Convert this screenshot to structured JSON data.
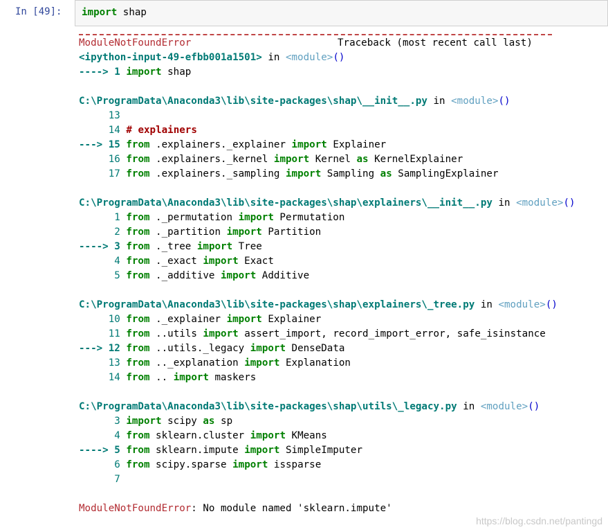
{
  "cell": {
    "prompt": "In  [49]:",
    "code_kw": "import",
    "code_rest": " shap"
  },
  "traceback": {
    "header_error": "ModuleNotFoundError",
    "header_right": "Traceback (most recent call last)",
    "frames": [
      {
        "location": "<ipython-input-49-efbb001a1501>",
        "in_word": " in ",
        "module": "<module>",
        "parens": "()",
        "lines": [
          {
            "marker": "----> ",
            "num": "1",
            "current": true,
            "kw1": "import",
            "rest1": " shap",
            "kw2": "",
            "rest2": "",
            "kw3": "",
            "rest3": ""
          }
        ]
      },
      {
        "location": "C:\\ProgramData\\Anaconda3\\lib\\site-packages\\shap\\__init__.py",
        "in_word": " in ",
        "module": "<module>",
        "parens": "()",
        "lines": [
          {
            "marker": "     ",
            "num": "13",
            "current": false,
            "kw1": "",
            "rest1": "",
            "kw2": "",
            "rest2": "",
            "kw3": "",
            "rest3": ""
          },
          {
            "marker": "     ",
            "num": "14",
            "current": false,
            "comment": "# explainers"
          },
          {
            "marker": "---> ",
            "num": "15",
            "current": true,
            "kw1": "from",
            "rest1": " .explainers._explainer ",
            "kw2": "import",
            "rest2": " Explainer",
            "kw3": "",
            "rest3": ""
          },
          {
            "marker": "     ",
            "num": "16",
            "current": false,
            "kw1": "from",
            "rest1": " .explainers._kernel ",
            "kw2": "import",
            "rest2": " Kernel ",
            "kw3": "as",
            "rest3": " KernelExplainer"
          },
          {
            "marker": "     ",
            "num": "17",
            "current": false,
            "kw1": "from",
            "rest1": " .explainers._sampling ",
            "kw2": "import",
            "rest2": " Sampling ",
            "kw3": "as",
            "rest3": " SamplingExplainer"
          }
        ]
      },
      {
        "location": "C:\\ProgramData\\Anaconda3\\lib\\site-packages\\shap\\explainers\\__init__.py",
        "in_word": " in ",
        "module": "<module>",
        "parens": "()",
        "lines": [
          {
            "marker": "      ",
            "num": "1",
            "current": false,
            "kw1": "from",
            "rest1": " ._permutation ",
            "kw2": "import",
            "rest2": " Permutation",
            "kw3": "",
            "rest3": ""
          },
          {
            "marker": "      ",
            "num": "2",
            "current": false,
            "kw1": "from",
            "rest1": " ._partition ",
            "kw2": "import",
            "rest2": " Partition",
            "kw3": "",
            "rest3": ""
          },
          {
            "marker": "----> ",
            "num": "3",
            "current": true,
            "kw1": "from",
            "rest1": " ._tree ",
            "kw2": "import",
            "rest2": " Tree",
            "kw3": "",
            "rest3": ""
          },
          {
            "marker": "      ",
            "num": "4",
            "current": false,
            "kw1": "from",
            "rest1": " ._exact ",
            "kw2": "import",
            "rest2": " Exact",
            "kw3": "",
            "rest3": ""
          },
          {
            "marker": "      ",
            "num": "5",
            "current": false,
            "kw1": "from",
            "rest1": " ._additive ",
            "kw2": "import",
            "rest2": " Additive",
            "kw3": "",
            "rest3": ""
          }
        ]
      },
      {
        "location": "C:\\ProgramData\\Anaconda3\\lib\\site-packages\\shap\\explainers\\_tree.py",
        "in_word": " in ",
        "module": "<module>",
        "parens": "()",
        "lines": [
          {
            "marker": "     ",
            "num": "10",
            "current": false,
            "kw1": "from",
            "rest1": " ._explainer ",
            "kw2": "import",
            "rest2": " Explainer",
            "kw3": "",
            "rest3": ""
          },
          {
            "marker": "     ",
            "num": "11",
            "current": false,
            "kw1": "from",
            "rest1": " ..utils ",
            "kw2": "import",
            "rest2": " assert_import, record_import_error, safe_isinstance",
            "kw3": "",
            "rest3": ""
          },
          {
            "marker": "---> ",
            "num": "12",
            "current": true,
            "kw1": "from",
            "rest1": " ..utils._legacy ",
            "kw2": "import",
            "rest2": " DenseData",
            "kw3": "",
            "rest3": ""
          },
          {
            "marker": "     ",
            "num": "13",
            "current": false,
            "kw1": "from",
            "rest1": " .._explanation ",
            "kw2": "import",
            "rest2": " Explanation",
            "kw3": "",
            "rest3": ""
          },
          {
            "marker": "     ",
            "num": "14",
            "current": false,
            "kw1": "from",
            "rest1": " .. ",
            "kw2": "import",
            "rest2": " maskers",
            "kw3": "",
            "rest3": ""
          }
        ]
      },
      {
        "location": "C:\\ProgramData\\Anaconda3\\lib\\site-packages\\shap\\utils\\_legacy.py",
        "in_word": " in ",
        "module": "<module>",
        "parens": "()",
        "lines": [
          {
            "marker": "      ",
            "num": "3",
            "current": false,
            "kw1": "import",
            "rest1": " scipy ",
            "kw2": "as",
            "rest2": " sp",
            "kw3": "",
            "rest3": ""
          },
          {
            "marker": "      ",
            "num": "4",
            "current": false,
            "kw1": "from",
            "rest1": " sklearn.cluster ",
            "kw2": "import",
            "rest2": " KMeans",
            "kw3": "",
            "rest3": ""
          },
          {
            "marker": "----> ",
            "num": "5",
            "current": true,
            "kw1": "from",
            "rest1": " sklearn.impute ",
            "kw2": "import",
            "rest2": " SimpleImputer",
            "kw3": "",
            "rest3": ""
          },
          {
            "marker": "      ",
            "num": "6",
            "current": false,
            "kw1": "from",
            "rest1": " scipy.sparse ",
            "kw2": "import",
            "rest2": " issparse",
            "kw3": "",
            "rest3": ""
          },
          {
            "marker": "      ",
            "num": "7",
            "current": false,
            "kw1": "",
            "rest1": "",
            "kw2": "",
            "rest2": "",
            "kw3": "",
            "rest3": ""
          }
        ]
      }
    ],
    "final_error": "ModuleNotFoundError",
    "final_message": ": No module named 'sklearn.impute'"
  },
  "watermark": "https://blog.csdn.net/pantingd"
}
